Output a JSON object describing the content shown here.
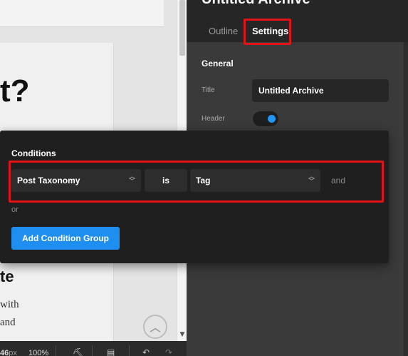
{
  "canvas": {
    "heading_fragment": "t?",
    "heading2_fragment": "te",
    "body_line1": "with",
    "body_line2": "and",
    "scroll_up_icon": "chevron-up-icon"
  },
  "bottom_toolbar": {
    "zoom_px_value": "46",
    "zoom_px_unit": "px",
    "zoom_percent": "100%",
    "icons": [
      "paint-roller-icon",
      "layout-icon",
      "undo-icon",
      "redo-icon"
    ]
  },
  "panel": {
    "title": "Untitled Archive",
    "tabs": [
      {
        "label": "Outline",
        "active": false
      },
      {
        "label": "Settings",
        "active": true
      }
    ],
    "section_title": "General",
    "title_field": {
      "label": "Title",
      "value": "Untitled Archive"
    },
    "header_field": {
      "label": "Header",
      "enabled": true
    }
  },
  "conditions": {
    "title": "Conditions",
    "rule": {
      "subject": "Post Taxonomy",
      "operator": "is",
      "value": "Tag",
      "joiner": "and"
    },
    "or_label": "or",
    "add_group_label": "Add Condition Group"
  },
  "colors": {
    "accent": "#2196f3",
    "button": "#1e8ff0",
    "highlight": "#e01418",
    "panel_bg": "#3a3a3a",
    "popup_bg": "#1f1f1f"
  }
}
